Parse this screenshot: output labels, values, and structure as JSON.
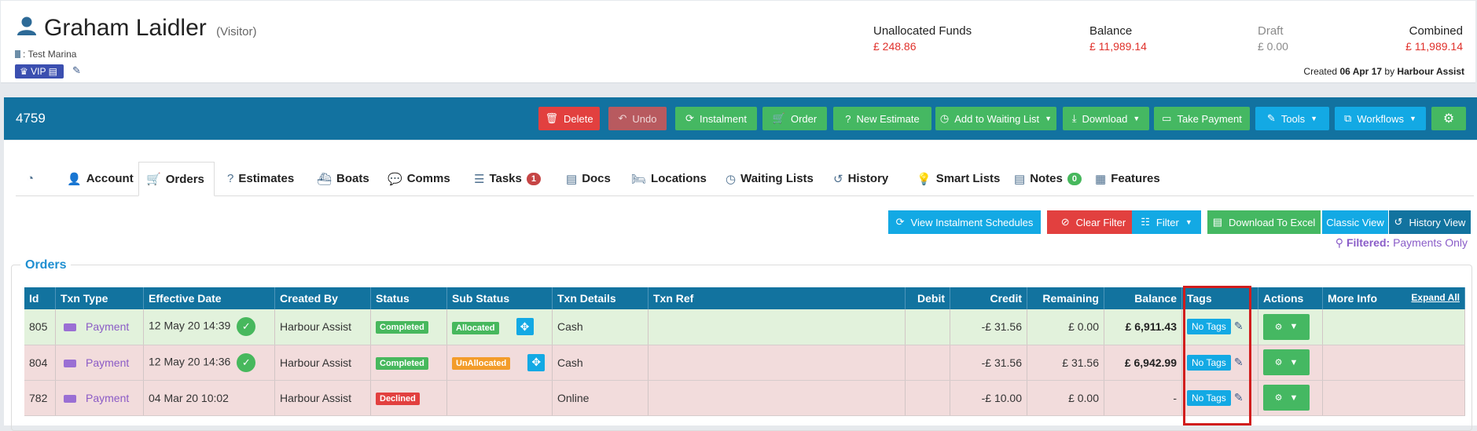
{
  "customer": {
    "name": "Graham Laidler",
    "type": "(Visitor)",
    "marina": ": Test Marina",
    "vip_label": "VIP"
  },
  "funds": [
    {
      "label": "Unallocated Funds",
      "value": "£ 248.86",
      "style": "red"
    },
    {
      "label": "Balance",
      "value": "£ 11,989.14",
      "style": "red"
    },
    {
      "label": "Draft",
      "value": "£ 0.00",
      "style": "grey"
    },
    {
      "label": "Combined",
      "value": "£ 11,989.14",
      "style": "red"
    }
  ],
  "created": {
    "prefix": "Created",
    "date": "06 Apr 17",
    "by": "by",
    "user": "Harbour Assist"
  },
  "account_id": "4759",
  "toolbar": {
    "delete": "Delete",
    "undo": "Undo",
    "instalment": "Instalment",
    "order": "Order",
    "new_estimate": "New Estimate",
    "add_waiting": "Add to Waiting List",
    "download": "Download",
    "take_payment": "Take Payment",
    "tools": "Tools",
    "workflows": "Workflows"
  },
  "tabs": [
    {
      "label": ""
    },
    {
      "label": "Account"
    },
    {
      "label": "Orders"
    },
    {
      "label": "Estimates"
    },
    {
      "label": "Boats"
    },
    {
      "label": "Comms"
    },
    {
      "label": "Tasks",
      "badge": "1"
    },
    {
      "label": "Docs"
    },
    {
      "label": "Locations"
    },
    {
      "label": "Waiting Lists"
    },
    {
      "label": "History"
    },
    {
      "label": "Smart Lists"
    },
    {
      "label": "Notes",
      "badge": "0"
    },
    {
      "label": "Features"
    }
  ],
  "actions": {
    "view_schedules": "View Instalment Schedules",
    "clear_filter": "Clear Filter",
    "filter": "Filter",
    "download_excel": "Download To Excel",
    "classic_view": "Classic View",
    "history_view": "History View"
  },
  "filter_status": {
    "label": "Filtered:",
    "value": "Payments Only"
  },
  "orders": {
    "title": "Orders",
    "columns": [
      "Id",
      "Txn Type",
      "Effective Date",
      "Created By",
      "Status",
      "Sub Status",
      "Txn Details",
      "Txn Ref",
      "Debit",
      "Credit",
      "Remaining",
      "Balance",
      "Tags",
      "Actions",
      "More Info"
    ],
    "expand_all": "Expand All",
    "rows": [
      {
        "id": "805",
        "txn_type": "Payment",
        "date": "12 May 20 14:39",
        "created_by": "Harbour Assist",
        "status": "Completed",
        "sub_status": "Allocated",
        "details": "Cash",
        "ref": "",
        "debit": "",
        "credit": "-£ 31.56",
        "remaining": "£ 0.00",
        "balance": "£ 6,911.43",
        "tag": "No Tags"
      },
      {
        "id": "804",
        "txn_type": "Payment",
        "date": "12 May 20 14:36",
        "created_by": "Harbour Assist",
        "status": "Completed",
        "sub_status": "UnAllocated",
        "details": "Cash",
        "ref": "",
        "debit": "",
        "credit": "-£ 31.56",
        "remaining": "£ 31.56",
        "balance": "£ 6,942.99",
        "tag": "No Tags"
      },
      {
        "id": "782",
        "txn_type": "Payment",
        "date": "04 Mar 20 10:02",
        "created_by": "Harbour Assist",
        "status": "Declined",
        "sub_status": "",
        "details": "Online",
        "ref": "",
        "debit": "",
        "credit": "-£ 10.00",
        "remaining": "£ 0.00",
        "balance": "-",
        "tag": "No Tags"
      }
    ]
  },
  "colors": {
    "brand_blue": "#12739f",
    "success": "#45b862",
    "danger": "#e2403f",
    "info": "#13a9e4",
    "highlight": "#d11d1d"
  }
}
